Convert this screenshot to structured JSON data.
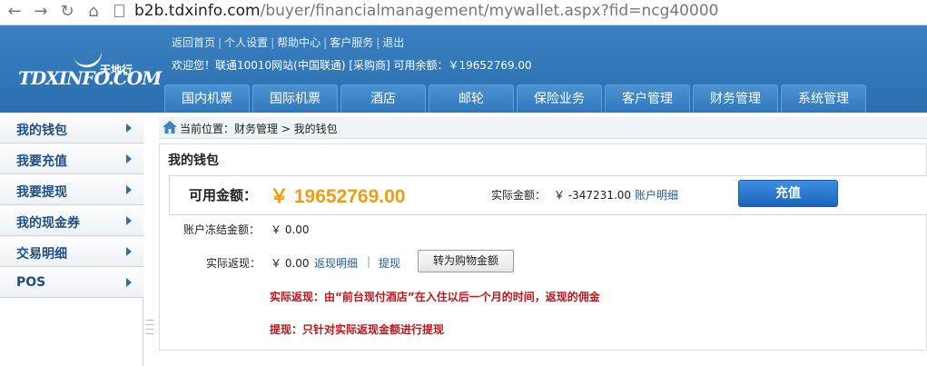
{
  "browser": {
    "url_host": "b2b.tdxinfo.com",
    "url_path": "/buyer/financialmanagement/mywallet.aspx?fid=ncg40000"
  },
  "logo": {
    "main": "TDXINFO.COM",
    "cn": "天地行"
  },
  "header": {
    "links": [
      "返回首页",
      "个人设置",
      "帮助中心",
      "客户服务",
      "退出"
    ],
    "welcome": "欢迎您！联通10010网站(中国联通) [采购商] 可用余额：￥19652769.00"
  },
  "menu": [
    "国内机票",
    "国际机票",
    "酒店",
    "邮轮",
    "保险业务",
    "客户管理",
    "财务管理",
    "系统管理"
  ],
  "sidebar": {
    "items": [
      {
        "label": "我的钱包"
      },
      {
        "label": "我要充值"
      },
      {
        "label": "我要提现"
      },
      {
        "label": "我的现金券"
      },
      {
        "label": "交易明细"
      },
      {
        "label": "POS"
      }
    ]
  },
  "breadcrumb": {
    "text": "当前位置：财务管理 > 我的钱包"
  },
  "wallet": {
    "title": "我的钱包",
    "available_label": "可用金额：",
    "available_amount": "￥ 19652769.00",
    "actual_label": "实际金额：",
    "actual_amount": "￥ -347231.00",
    "account_detail_link": "账户明细",
    "recharge_button": "充值",
    "frozen_label": "账户冻结金额：",
    "frozen_amount": "￥ 0.00",
    "rebate_label": "实际返现：",
    "rebate_amount": "￥ 0.00",
    "rebate_detail_link": "返现明细",
    "link_separator": "|",
    "withdraw_link": "提现",
    "convert_button": "转为购物金额",
    "note_rebate": "实际返现：由“前台现付酒店”在入住以后一个月的时间，返现的佣金",
    "note_withdraw": "提现：只针对实际返现金额进行提现"
  },
  "colors": {
    "header_blue": "#2c72b5",
    "amount_orange": "#f39c12",
    "note_red": "#c8131a",
    "link_blue": "#1f5fa8"
  }
}
